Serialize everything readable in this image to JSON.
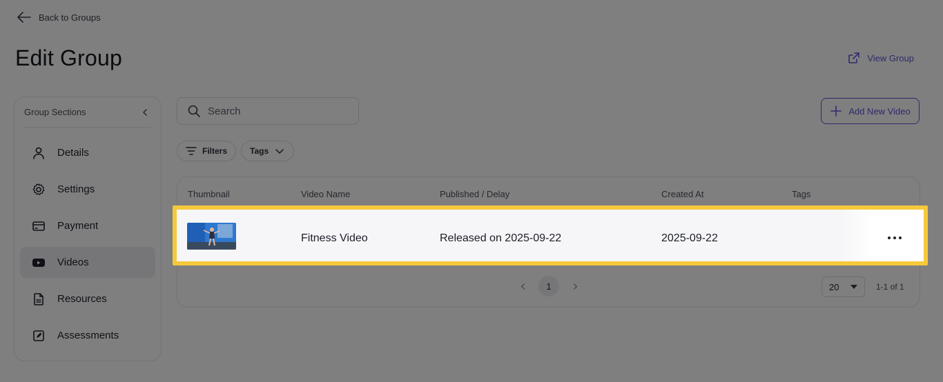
{
  "header": {
    "back_label": "Back to Groups",
    "title": "Edit Group",
    "view_group_label": "View Group"
  },
  "sidebar": {
    "title": "Group Sections",
    "items": [
      {
        "label": "Details",
        "icon": "user-icon"
      },
      {
        "label": "Settings",
        "icon": "gear-icon"
      },
      {
        "label": "Payment",
        "icon": "credit-card-icon"
      },
      {
        "label": "Videos",
        "icon": "play-video-icon",
        "active": true
      },
      {
        "label": "Resources",
        "icon": "document-icon"
      },
      {
        "label": "Assessments",
        "icon": "edit-square-icon"
      }
    ]
  },
  "toolbar": {
    "search_placeholder": "Search",
    "add_video_label": "Add New Video",
    "filters_label": "Filters",
    "tags_label": "Tags"
  },
  "table": {
    "columns": [
      "Thumbnail",
      "Video Name",
      "Published / Delay",
      "Created At",
      "Tags"
    ],
    "rows": [
      {
        "thumbnail": "fitness-video-thumbnail",
        "video_name": "Fitness Video",
        "published": "Released on 2025-09-22",
        "created_at": "2025-09-22",
        "tags": ""
      }
    ]
  },
  "pagination": {
    "current_page": "1",
    "per_page": "20",
    "range": "1-1 of 1"
  },
  "colors": {
    "accent": "#5b55d6",
    "highlight": "#f6c93b",
    "overlay": "rgba(0,0,0,0.5)"
  }
}
